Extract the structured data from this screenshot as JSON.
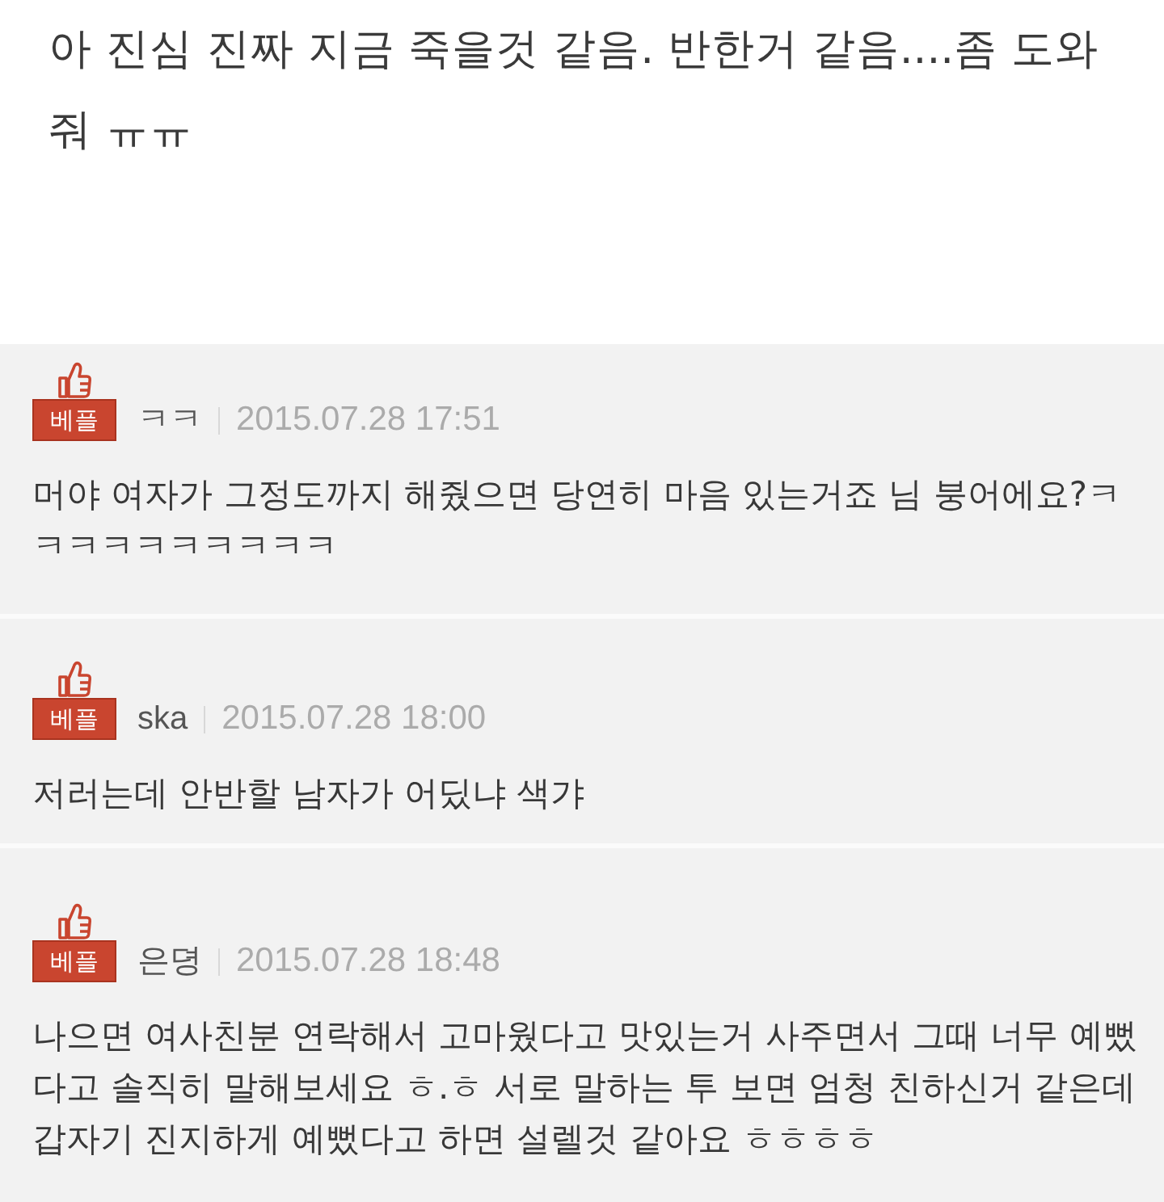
{
  "post": {
    "text": "아 진심 진짜 지금 죽을것 같음. 반한거 같음....좀 도와줘 ㅠㅠ"
  },
  "comments": [
    {
      "badge": "베플",
      "nickname": "ㅋㅋ",
      "date": "2015.07.28 17:51",
      "text": "머야 여자가 그정도까지 해줬으면 당연히 마음 있는거죠 님 붕어에요?ㅋㅋㅋㅋㅋㅋㅋㅋㅋㅋ"
    },
    {
      "badge": "베플",
      "nickname": "ska",
      "date": "2015.07.28 18:00",
      "text": "저러는데 안반할 남자가 어딨냐 색갸"
    },
    {
      "badge": "베플",
      "nickname": "은뎡",
      "date": "2015.07.28 18:48",
      "text": "나으면 여사친분 연락해서 고마웠다고 맛있는거 사주면서 그때 너무 예뻤다고 솔직히 말해보세요 ㅎ.ㅎ 서로 말하는 투 보면 엄청 친하신거 같은데 갑자기 진지하게 예뻤다고 하면 설렐것 같아요 ㅎㅎㅎㅎ"
    }
  ]
}
